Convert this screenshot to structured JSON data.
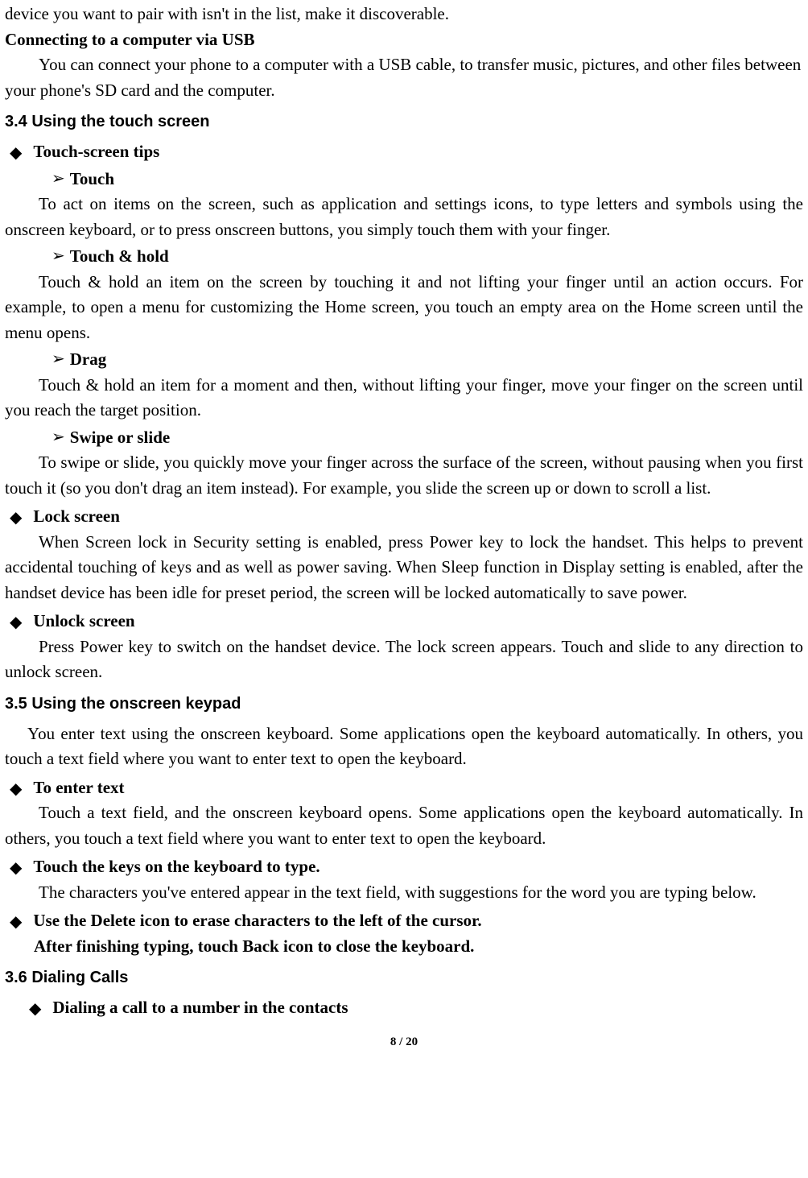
{
  "top_frag": "device you want to pair with isn't in the list, make it discoverable.",
  "usb_head": "Connecting to a computer via USB",
  "usb_body": "You can connect your phone to a computer with a USB cable, to transfer music, pictures, and other files between your phone's SD card and the computer.",
  "s34": "3.4    Using the touch screen",
  "tips_head": "Touch-screen tips",
  "touch_h": "Touch",
  "touch_b": "To act on items on the screen, such as application and settings icons, to type letters and symbols using the onscreen keyboard, or to press onscreen buttons, you simply touch them with your finger.",
  "hold_h": "Touch & hold",
  "hold_b": "Touch & hold an item on the screen by touching it and not lifting your finger until an action occurs. For example, to open a menu for customizing the Home screen, you touch an empty area on the Home screen until the menu opens.",
  "drag_h": "Drag",
  "drag_b": "Touch & hold an item for a moment and then, without lifting your finger, move your finger on the screen until you reach the target position.",
  "swipe_h": "Swipe or slide",
  "swipe_b": "To swipe or slide, you quickly move your finger across the surface of the screen, without pausing when you first touch it (so you don't drag an item instead). For example, you slide the screen up or down to scroll a list.",
  "lock_h": "Lock screen",
  "lock_b": "When Screen lock in Security setting is enabled, press Power key to lock the handset. This helps to prevent accidental touching of keys and as well as power saving. When Sleep function in Display setting is enabled, after the handset device has been idle for preset period, the screen will be locked automatically to save power.",
  "unlock_h": "Unlock screen",
  "unlock_b": "Press Power key to switch on the handset device. The lock screen appears. Touch and slide to any direction to unlock screen.",
  "s35": "3.5    Using the onscreen keypad",
  "keypad_intro": "You enter text using the onscreen keyboard. Some applications open the keyboard automatically. In others, you touch a text field where you want to enter text to open the keyboard.",
  "enter_h": "To enter text",
  "enter_b": "Touch a text field, and the onscreen keyboard opens. Some applications open the keyboard automatically. In others, you touch a text field where you want to enter text to open the keyboard.",
  "keys_h": "Touch the keys on the keyboard to type.",
  "keys_b": "The characters you've entered appear in the text field, with suggestions for the word you are typing below.",
  "delete_h": "Use the Delete icon to erase characters to the left of the cursor.",
  "after_typing": "After finishing typing, touch Back icon to close the keyboard.",
  "s36": "3.6    Dialing Calls",
  "dial_h": "Dialing a call to a number in the contacts",
  "footer": "8 / 20"
}
